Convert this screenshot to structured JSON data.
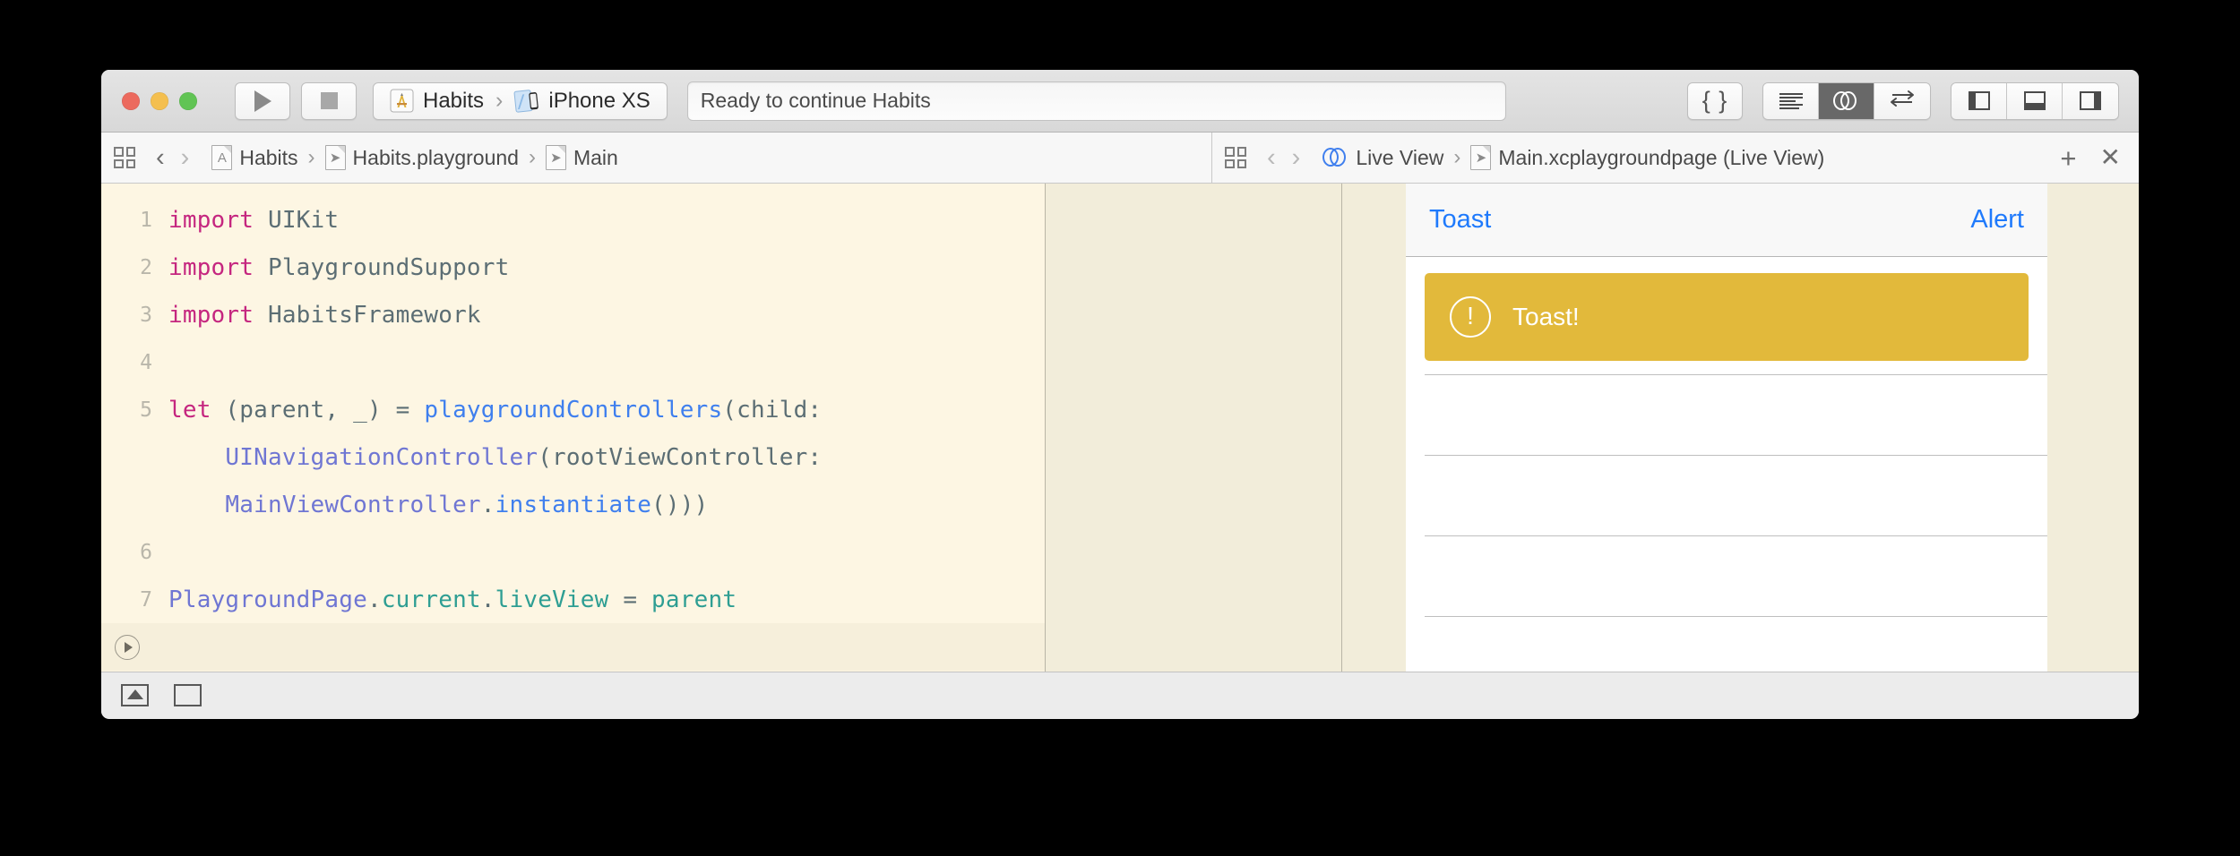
{
  "window": {
    "traffic_lights": [
      {
        "name": "close",
        "color": "#ec6a5e"
      },
      {
        "name": "minimize",
        "color": "#f4bf4f"
      },
      {
        "name": "zoom",
        "color": "#61c454"
      }
    ]
  },
  "toolbar": {
    "run_icon": "play-icon",
    "stop_icon": "stop-icon",
    "scheme": {
      "project_name": "Habits",
      "project_icon": "xcode-scheme-icon",
      "separator": "›",
      "destination_name": "iPhone XS",
      "destination_icon": "simulator-device-icon"
    },
    "status_text": "Ready to continue Habits",
    "braces_label": "{ }",
    "editor_modes": [
      {
        "name": "standard-editor",
        "icon": "lines-icon",
        "active": false
      },
      {
        "name": "assistant-editor",
        "icon": "venn-icon",
        "active": true
      },
      {
        "name": "version-editor",
        "icon": "swap-arrows-icon",
        "active": false
      }
    ],
    "panel_toggles": [
      {
        "name": "navigator",
        "icon": "panel-left-icon"
      },
      {
        "name": "debug-area",
        "icon": "panel-bottom-icon"
      },
      {
        "name": "utilities",
        "icon": "panel-right-icon"
      }
    ]
  },
  "jumpbar_left": {
    "grid_icon": "related-items-icon",
    "back_arrow": "‹",
    "forward_arrow": "›",
    "crumbs": [
      {
        "label": "Habits",
        "icon": "project-icon"
      },
      {
        "label": "Habits.playground",
        "icon": "playground-icon"
      },
      {
        "label": "Main",
        "icon": "playground-page-icon"
      }
    ],
    "separator": "›"
  },
  "jumpbar_right": {
    "grid_icon": "related-items-icon",
    "back_arrow": "‹",
    "forward_arrow": "›",
    "crumbs": [
      {
        "label": "Live View",
        "icon": "assistant-venn-icon"
      },
      {
        "label": "Main.xcplaygroundpage (Live View)",
        "icon": "playground-page-icon"
      }
    ],
    "separator": "›",
    "add_label": "+",
    "close_label": "✕"
  },
  "editor": {
    "lines": [
      {
        "number": "1",
        "tokens": [
          {
            "t": "import",
            "c": "kw"
          },
          {
            "t": " UIKit",
            "c": "pun"
          }
        ]
      },
      {
        "number": "2",
        "tokens": [
          {
            "t": "import",
            "c": "kw"
          },
          {
            "t": " PlaygroundSupport",
            "c": "pun"
          }
        ]
      },
      {
        "number": "3",
        "tokens": [
          {
            "t": "import",
            "c": "kw"
          },
          {
            "t": " HabitsFramework",
            "c": "pun"
          }
        ]
      },
      {
        "number": "4",
        "tokens": []
      },
      {
        "number": "5",
        "tokens": [
          {
            "t": "let",
            "c": "kw"
          },
          {
            "t": " (parent, _) = ",
            "c": "pun"
          },
          {
            "t": "playgroundControllers",
            "c": "fn"
          },
          {
            "t": "(child:",
            "c": "pun"
          }
        ]
      },
      {
        "number": "",
        "tokens": [
          {
            "t": "    ",
            "c": "pun"
          },
          {
            "t": "UINavigationController",
            "c": "typ"
          },
          {
            "t": "(rootViewController:",
            "c": "pun"
          }
        ]
      },
      {
        "number": "",
        "tokens": [
          {
            "t": "    ",
            "c": "pun"
          },
          {
            "t": "MainViewController",
            "c": "typ"
          },
          {
            "t": ".",
            "c": "pun"
          },
          {
            "t": "instantiate",
            "c": "fn"
          },
          {
            "t": "()))",
            "c": "pun"
          }
        ]
      },
      {
        "number": "6",
        "tokens": []
      },
      {
        "number": "7",
        "tokens": [
          {
            "t": "PlaygroundPage",
            "c": "typ"
          },
          {
            "t": ".",
            "c": "pun"
          },
          {
            "t": "current",
            "c": "prop"
          },
          {
            "t": ".",
            "c": "pun"
          },
          {
            "t": "liveView",
            "c": "prop"
          },
          {
            "t": " = ",
            "c": "pun"
          },
          {
            "t": "parent",
            "c": "prop"
          }
        ]
      }
    ],
    "run_button_icon": "execute-line-icon"
  },
  "liveview": {
    "nav_left_label": "Toast",
    "nav_right_label": "Alert",
    "toast": {
      "icon": "exclamation-circle-icon",
      "glyph": "!",
      "message": "Toast!",
      "background": "#e2b93b"
    },
    "row_separators": 4
  },
  "bottombar": {
    "buttons": [
      {
        "name": "hide-debug-area-button",
        "icon": "triangle-in-box-icon"
      },
      {
        "name": "show-debug-console-button",
        "icon": "empty-box-icon"
      }
    ]
  },
  "colors": {
    "editor_background": "#fdf6e3",
    "results_sidebar": "#f2edda",
    "accent_blue": "#1f7afc",
    "keyword_pink": "#c5267f",
    "type_purple": "#6f76d3",
    "function_blue": "#3f7fee",
    "property_teal": "#2e9e93",
    "toast_gold": "#e2b93b"
  }
}
